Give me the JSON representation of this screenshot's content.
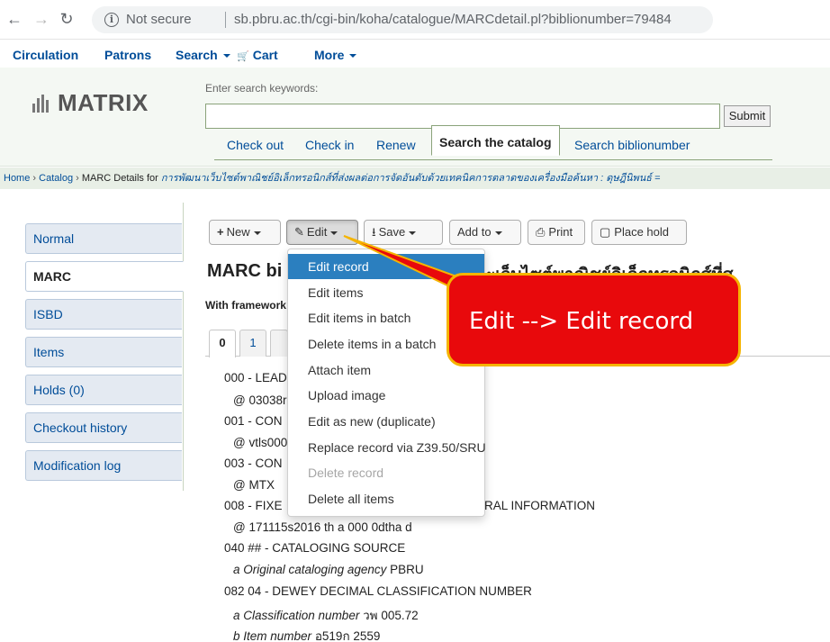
{
  "browser": {
    "security": "Not secure",
    "url": "sb.pbru.ac.th/cgi-bin/koha/catalogue/MARCdetail.pl?biblionumber=79484"
  },
  "topmenu": {
    "circulation": "Circulation",
    "patrons": "Patrons",
    "search": "Search",
    "cart": "Cart",
    "more": "More"
  },
  "header": {
    "logo": "MATRIX",
    "search_label": "Enter search keywords:",
    "search_value": "",
    "submit": "Submit",
    "tabs": [
      "Check out",
      "Check in",
      "Renew",
      "Search the catalog",
      "Search biblionumber"
    ]
  },
  "breadcrumb": {
    "home": "Home",
    "catalog": "Catalog",
    "prefix": "MARC Details for",
    "title": "การพัฒนาเว็บไซต์พาณิชย์อิเล็กทรอนิกส์ที่ส่งผลต่อการจัดอันดับด้วยเทคนิคการตลาดของเครื่องมือค้นหา : ดุษฎีนิพนธ์ ="
  },
  "sidebar": {
    "items": [
      "Normal",
      "MARC",
      "ISBD",
      "Items",
      "Holds (0)",
      "Checkout history",
      "Modification log"
    ]
  },
  "toolbar": {
    "new": "New",
    "edit": "Edit",
    "save": "Save",
    "add_to": "Add to",
    "print": "Print",
    "place_hold": "Place hold"
  },
  "page": {
    "title_visible": "MARC bi",
    "title_thai_tail": "ะเว็บไซต์พาณิชย์อิเล็กทรอนิกส์ที่ส",
    "framework": "With framework"
  },
  "tag_tabs": [
    "0",
    "1"
  ],
  "marc": {
    "lines": [
      "000 - LEAD",
      "@ 03038r",
      "001 - CON",
      "@ vtls000",
      "003 - CON",
      "@ MTX",
      "008 - FIXE",
      "RAL INFORMATION",
      "@ 171115s2016 th a 000 0dtha d",
      "040 ## - CATALOGING SOURCE",
      "Original cataloging agency",
      "PBRU",
      "082 04 - DEWEY DECIMAL CLASSIFICATION NUMBER",
      "Classification number",
      "วพ 005.72",
      "Item number",
      "อ519ก 2559"
    ]
  },
  "dropdown": {
    "items": [
      "Edit record",
      "Edit items",
      "Edit items in batch",
      "Delete items in a batch",
      "Attach item",
      "Upload image",
      "Edit as new (duplicate)",
      "Replace record via Z39.50/SRU",
      "Delete record",
      "Delete all items"
    ]
  },
  "callout": {
    "text": "Edit --> Edit record"
  },
  "colors": {
    "link": "#004d99",
    "highlight": "#2b7fbf",
    "callout_fill": "#e8090c",
    "callout_border": "#f5b400"
  }
}
